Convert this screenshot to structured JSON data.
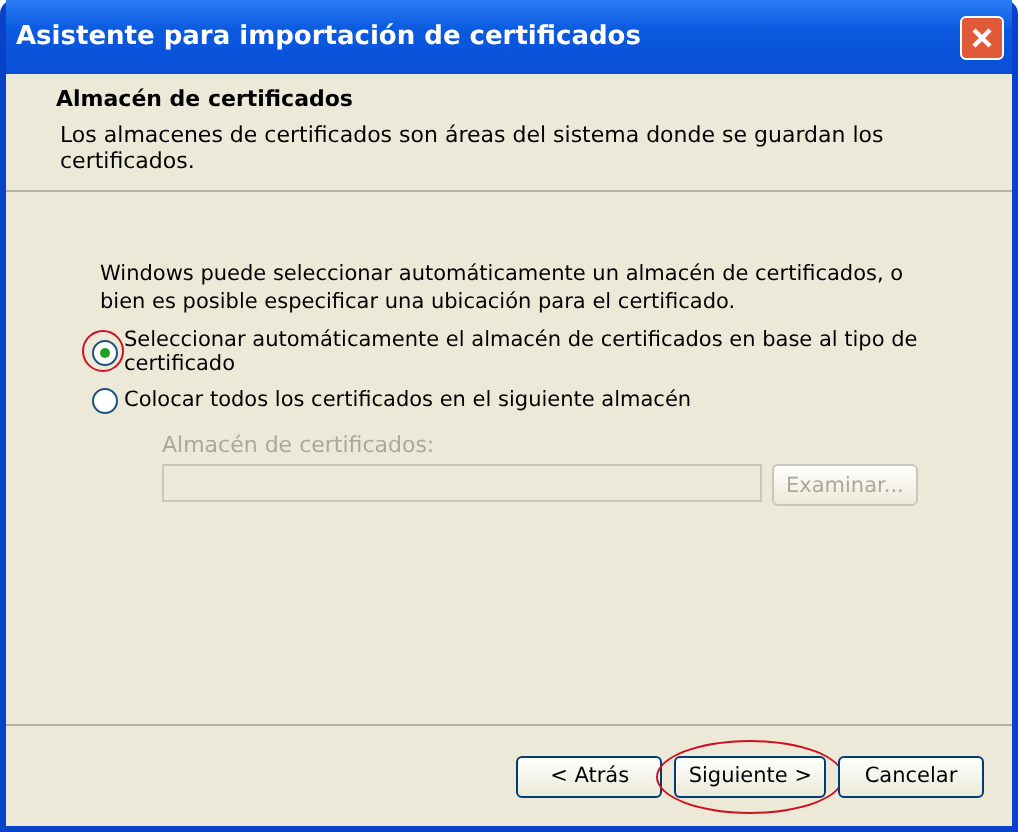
{
  "window": {
    "title": "Asistente para importación de certificados"
  },
  "header": {
    "title": "Almacén de certificados",
    "description": "Los almacenes de certificados son áreas del sistema donde se guardan los certificados."
  },
  "intro": "Windows puede seleccionar automáticamente un almacén de certificados, o bien es posible especificar una ubicación para el certificado.",
  "options": [
    {
      "label": "Seleccionar automáticamente el almacén de certificados en base al tipo de certificado",
      "selected": true,
      "highlighted": true
    },
    {
      "label": "Colocar todos los certificados en el siguiente almacén",
      "selected": false,
      "highlighted": false
    }
  ],
  "store": {
    "label": "Almacén de certificados:",
    "disabled": true,
    "browse_button": "Examinar..."
  },
  "buttons": [
    {
      "label": "< Atrás",
      "highlighted": false
    },
    {
      "label": "Siguiente >",
      "highlighted": true
    },
    {
      "label": "Cancelar",
      "highlighted": false
    }
  ]
}
